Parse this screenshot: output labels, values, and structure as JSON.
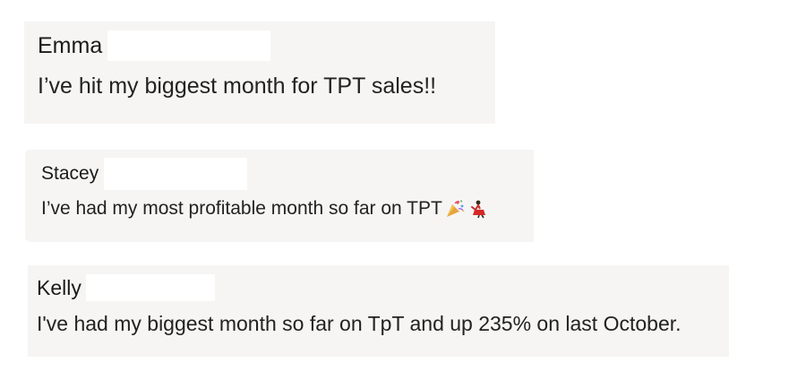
{
  "comments": [
    {
      "author": "Emma",
      "message": "I’ve hit my biggest month for TPT sales!!"
    },
    {
      "author": "Stacey",
      "message": "I’ve had my most profitable month so far on TPT",
      "emojis": [
        "party-popper-icon",
        "dancer-icon"
      ]
    },
    {
      "author": "Kelly",
      "message": "I've had my biggest month so far on TpT and up 235% on last October."
    }
  ]
}
